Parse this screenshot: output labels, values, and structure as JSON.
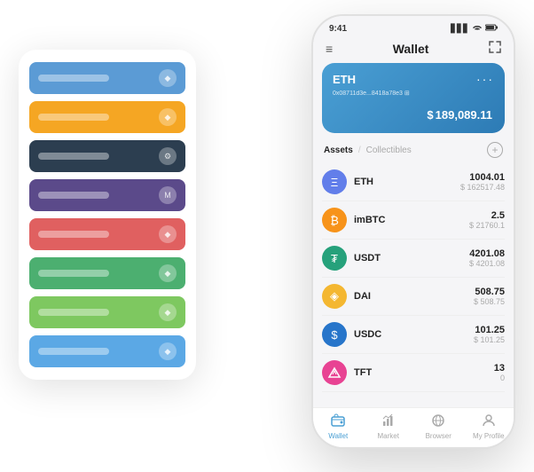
{
  "scene": {
    "left_panel": {
      "cards": [
        {
          "id": "card-blue",
          "color_class": "strip-blue",
          "icon": "◆"
        },
        {
          "id": "card-orange",
          "color_class": "strip-orange",
          "icon": "◆"
        },
        {
          "id": "card-dark",
          "color_class": "strip-dark",
          "icon": "⚙"
        },
        {
          "id": "card-purple",
          "color_class": "strip-purple",
          "icon": "M"
        },
        {
          "id": "card-red",
          "color_class": "strip-red",
          "icon": "◆"
        },
        {
          "id": "card-green",
          "color_class": "strip-green",
          "icon": "◆"
        },
        {
          "id": "card-lightgreen",
          "color_class": "strip-lightgreen",
          "icon": "◆"
        },
        {
          "id": "card-skyblue",
          "color_class": "strip-skyblue",
          "icon": "◆"
        }
      ]
    },
    "phone": {
      "status_bar": {
        "time": "9:41",
        "signal": "▋▋▋",
        "wifi": "WiFi",
        "battery": "🔋"
      },
      "header": {
        "menu_icon": "≡",
        "title": "Wallet",
        "expand_icon": "⤢"
      },
      "wallet_card": {
        "coin": "ETH",
        "dots": "···",
        "address": "0x08711d3e...8418a78e3 ⊞",
        "currency_symbol": "$",
        "balance": "189,089.11"
      },
      "assets_section": {
        "tab_active": "Assets",
        "divider": "/",
        "tab_inactive": "Collectibles",
        "add_icon": "+"
      },
      "assets": [
        {
          "id": "eth",
          "name": "ETH",
          "icon_text": "Ξ",
          "icon_class": "eth-icon",
          "amount": "1004.01",
          "usd": "$ 162517.48"
        },
        {
          "id": "imbtc",
          "name": "imBTC",
          "icon_text": "₿",
          "icon_class": "imbtc-icon",
          "amount": "2.5",
          "usd": "$ 21760.1"
        },
        {
          "id": "usdt",
          "name": "USDT",
          "icon_text": "₮",
          "icon_class": "usdt-icon",
          "amount": "4201.08",
          "usd": "$ 4201.08"
        },
        {
          "id": "dai",
          "name": "DAI",
          "icon_text": "◈",
          "icon_class": "dai-icon",
          "amount": "508.75",
          "usd": "$ 508.75"
        },
        {
          "id": "usdc",
          "name": "USDC",
          "icon_text": "$",
          "icon_class": "usdc-icon",
          "amount": "101.25",
          "usd": "$ 101.25"
        },
        {
          "id": "tft",
          "name": "TFT",
          "icon_text": "T",
          "icon_class": "tft-icon",
          "amount": "13",
          "usd": "0"
        }
      ],
      "bottom_nav": [
        {
          "id": "wallet",
          "icon": "◎",
          "label": "Wallet",
          "active": true
        },
        {
          "id": "market",
          "icon": "📊",
          "label": "Market",
          "active": false
        },
        {
          "id": "browser",
          "icon": "🌐",
          "label": "Browser",
          "active": false
        },
        {
          "id": "profile",
          "icon": "👤",
          "label": "My Profile",
          "active": false
        }
      ]
    }
  }
}
